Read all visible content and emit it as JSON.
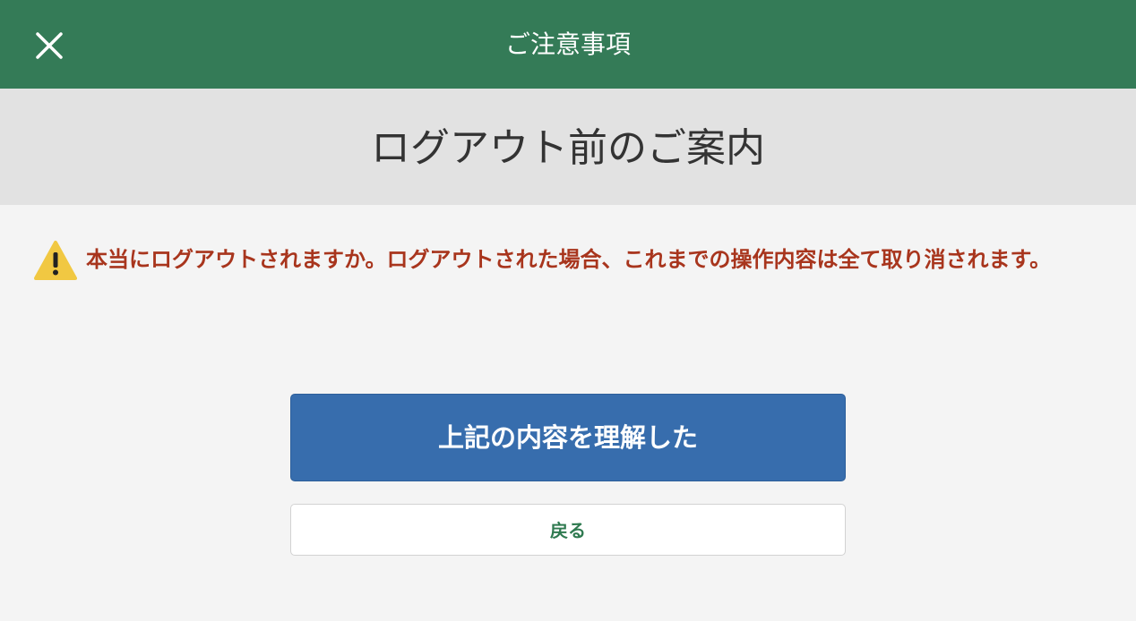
{
  "header": {
    "title": "ご注意事項",
    "close_icon": "close-icon"
  },
  "subheader": {
    "title": "ログアウト前のご案内"
  },
  "warning": {
    "icon": "warning-icon",
    "message": "本当にログアウトされますか。ログアウトされた場合、これまでの操作内容は全て取り消されます。"
  },
  "actions": {
    "confirm_label": "上記の内容を理解した",
    "back_label": "戻る"
  },
  "colors": {
    "header_bg": "#347b57",
    "subheader_bg": "#e2e2e2",
    "page_bg": "#f4f4f4",
    "warning_text": "#a8351d",
    "warning_icon": "#f1c842",
    "primary_button": "#376dad",
    "back_text": "#2f7a50"
  }
}
